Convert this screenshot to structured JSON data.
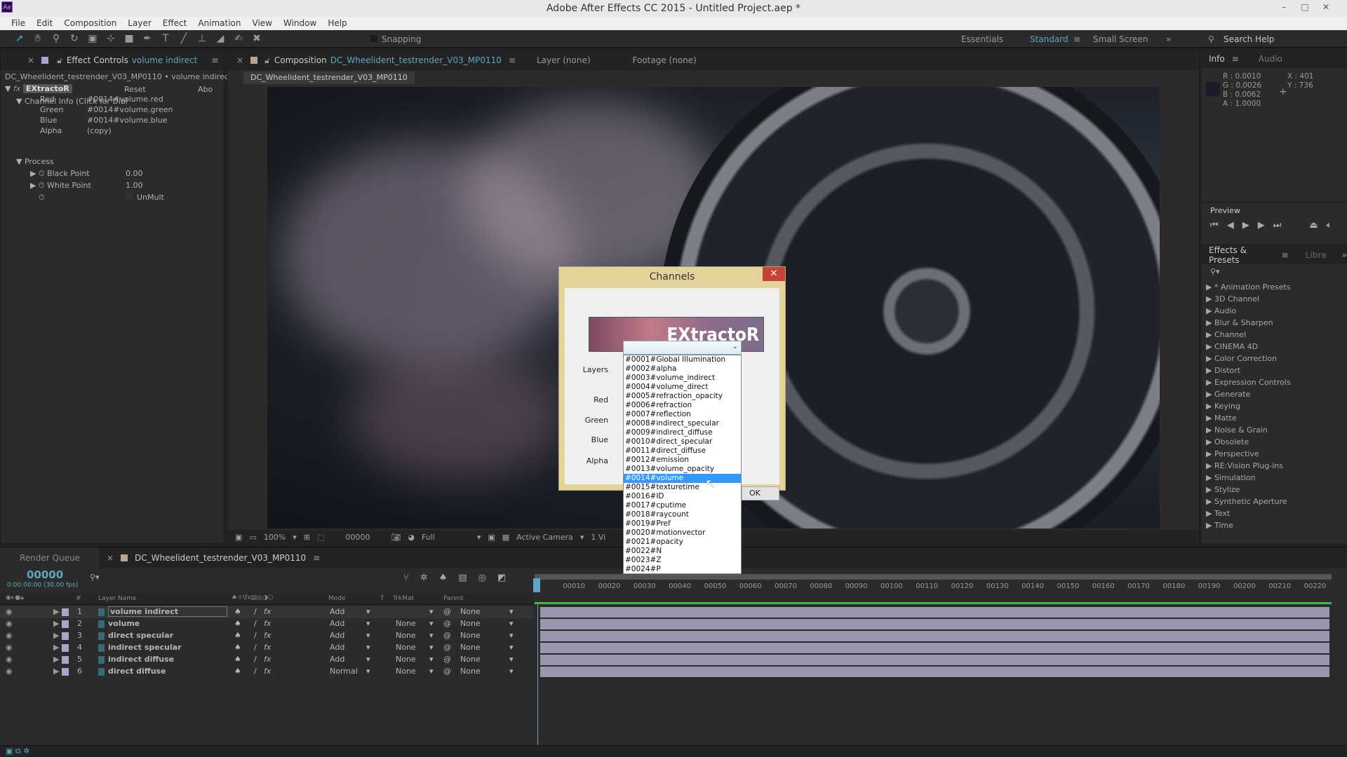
{
  "app": {
    "title": "Adobe After Effects CC 2015 - Untitled Project.aep *",
    "logo": "Ae"
  },
  "menu": [
    "File",
    "Edit",
    "Composition",
    "Layer",
    "Effect",
    "Animation",
    "View",
    "Window",
    "Help"
  ],
  "toolbar": {
    "tools": [
      "selection-icon",
      "hand-icon",
      "zoom-icon",
      "rotate-icon",
      "camera-icon",
      "pan-behind-icon",
      "rectangle-icon",
      "pen-icon",
      "type-icon",
      "brush-icon",
      "clone-stamp-icon",
      "eraser-icon",
      "roto-brush-icon",
      "puppet-pin-icon"
    ],
    "snapping": "Snapping"
  },
  "workspaces": {
    "essentials": "Essentials",
    "standard": "Standard",
    "small_screen": "Small Screen",
    "search_help": "Search Help"
  },
  "effect_controls": {
    "tab": "Effect Controls",
    "layer": "volume indirect",
    "breadcrumb": "DC_Wheelident_testrender_V03_MP0110 • volume indirect",
    "effect": "EXtractoR",
    "reset": "Reset",
    "about": "Abo",
    "channel_info": "Channel Info (Click for Dial",
    "channels": [
      {
        "name": "Red",
        "value": "#0014#volume.red"
      },
      {
        "name": "Green",
        "value": "#0014#volume.green"
      },
      {
        "name": "Blue",
        "value": "#0014#volume.blue"
      },
      {
        "name": "Alpha",
        "value": "(copy)"
      }
    ],
    "process": "Process",
    "black_point": {
      "label": "Black Point",
      "value": "0.00"
    },
    "white_point": {
      "label": "White Point",
      "value": "1.00"
    },
    "unmult": "UnMult"
  },
  "composition": {
    "tab": "Composition",
    "comp_name": "DC_Wheelident_testrender_V03_MP0110",
    "layer_tab": "Layer (none)",
    "footage_tab": "Footage (none)",
    "zoom": "100%",
    "timecode": "00000",
    "resolution": "Full",
    "camera": "Active Camera",
    "views": "1 Vi"
  },
  "info": {
    "tab": "Info",
    "audio_tab": "Audio",
    "r": "R : 0.0010",
    "g": "G : 0.0026",
    "b": "B : 0.0062",
    "a": "A : 1.0000",
    "x": "X : 401",
    "y": "Y : 736"
  },
  "preview": {
    "title": "Preview"
  },
  "effects_presets": {
    "tab": "Effects & Presets",
    "libraries_tab": "Libra",
    "items": [
      "* Animation Presets",
      "3D Channel",
      "Audio",
      "Blur & Sharpen",
      "Channel",
      "CINEMA 4D",
      "Color Correction",
      "Distort",
      "Expression Controls",
      "Generate",
      "Keying",
      "Matte",
      "Noise & Grain",
      "Obsolete",
      "Perspective",
      "RE:Vision Plug-ins",
      "Simulation",
      "Stylize",
      "Synthetic Aperture",
      "Text",
      "Time"
    ]
  },
  "dialog": {
    "title": "Channels",
    "banner": "EXtractoR",
    "layers_label": "Layers",
    "red": "Red",
    "green": "Green",
    "blue": "Blue",
    "alpha": "Alpha",
    "ok": "OK",
    "options": [
      "#0001#Global Illumination",
      "#0002#alpha",
      "#0003#volume_indirect",
      "#0004#volume_direct",
      "#0005#refraction_opacity",
      "#0006#refraction",
      "#0007#reflection",
      "#0008#indirect_specular",
      "#0009#indirect_diffuse",
      "#0010#direct_specular",
      "#0011#direct_diffuse",
      "#0012#emission",
      "#0013#volume_opacity",
      "#0014#volume",
      "#0015#texturetime",
      "#0016#ID",
      "#0017#cputime",
      "#0018#raycount",
      "#0019#Pref",
      "#0020#motionvector",
      "#0021#opacity",
      "#0022#N",
      "#0023#Z",
      "#0024#P"
    ],
    "highlighted": "#0014#volume"
  },
  "timeline": {
    "render_queue": "Render Queue",
    "comp_tab": "DC_Wheelident_testrender_V03_MP0110",
    "timecode": "00000",
    "timecode_sub": "0:00:00:00 (30.00 fps)",
    "headers": {
      "num": "#",
      "layer_name": "Layer Name",
      "mode": "Mode",
      "t": "T",
      "trkmat": "TrkMat",
      "parent": "Parent"
    },
    "layers": [
      {
        "num": "1",
        "name": "volume indirect",
        "mode": "Add",
        "trkmat": "",
        "parent": "None"
      },
      {
        "num": "2",
        "name": "volume",
        "mode": "Add",
        "trkmat": "None",
        "parent": "None"
      },
      {
        "num": "3",
        "name": "direct specular",
        "mode": "Add",
        "trkmat": "None",
        "parent": "None"
      },
      {
        "num": "4",
        "name": "indirect specular",
        "mode": "Add",
        "trkmat": "None",
        "parent": "None"
      },
      {
        "num": "5",
        "name": "indirect diffuse",
        "mode": "Add",
        "trkmat": "None",
        "parent": "None"
      },
      {
        "num": "6",
        "name": "direct diffuse",
        "mode": "Normal",
        "trkmat": "None",
        "parent": "None"
      }
    ],
    "ruler": [
      "00010",
      "00020",
      "00030",
      "00040",
      "00050",
      "00060",
      "00070",
      "00080",
      "00090",
      "00100",
      "00110",
      "00120",
      "00130",
      "00140",
      "00150",
      "00160",
      "00170",
      "00180",
      "00190",
      "00200",
      "00210",
      "00220"
    ]
  },
  "colors": {
    "accent": "#5fa6c4",
    "layer_bar": "#9a96ad",
    "work_area": "#3cc03c",
    "selection": "#3399ff",
    "dialog_frame": "#e5d49a"
  }
}
